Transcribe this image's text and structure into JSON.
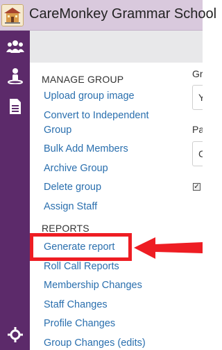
{
  "header": {
    "title": "CareMonkey Grammar School"
  },
  "sidebar": {
    "icons": [
      "users-icon",
      "person-icon",
      "document-icon",
      "settings-icon"
    ]
  },
  "menu": {
    "manage_group": {
      "title": "MANAGE GROUP",
      "items": [
        "Upload group image",
        "Convert to Independent",
        "Group",
        "Bulk Add Members",
        "Archive Group",
        "Delete group",
        "Assign Staff"
      ]
    },
    "reports": {
      "title": "REPORTS",
      "items": [
        "Generate report",
        "Roll Call Reports",
        "Membership Changes",
        "Staff Changes",
        "Profile Changes",
        "Group Changes (edits)"
      ]
    }
  },
  "right_panel": {
    "label1": "Gr",
    "input1_value": "Y",
    "label2": "Pa",
    "input2_value": "C"
  },
  "colors": {
    "sidebar": "#5c2a6a",
    "link": "#2a6fae",
    "highlight": "#ee1d23",
    "topbar": "#d9c9dd"
  }
}
